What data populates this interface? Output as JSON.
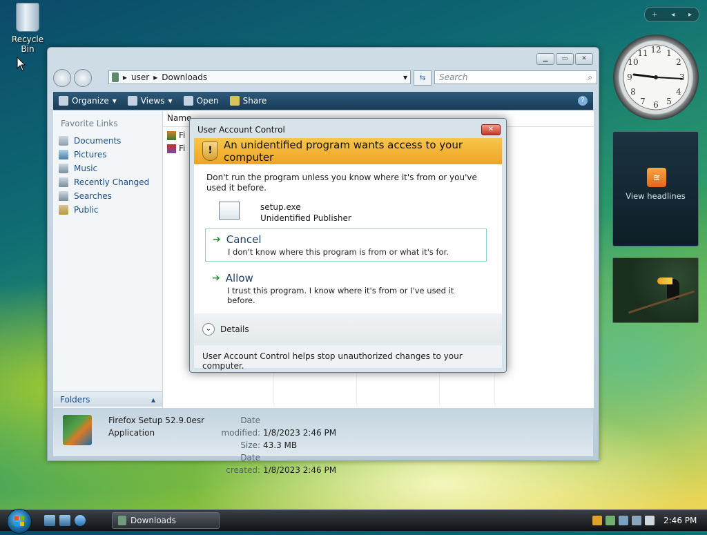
{
  "desktop": {
    "recycle_bin_label": "Recycle Bin"
  },
  "explorer": {
    "window_title": "Downloads",
    "breadcrumb": [
      "user",
      "Downloads"
    ],
    "search_placeholder": "Search",
    "toolbar": {
      "organize": "Organize",
      "views": "Views",
      "open": "Open",
      "share": "Share"
    },
    "favorite_links_title": "Favorite Links",
    "favorite_links": [
      "Documents",
      "Pictures",
      "Music",
      "Recently Changed",
      "Searches",
      "Public"
    ],
    "folders_label": "Folders",
    "column_headers": [
      "Name"
    ],
    "files": [
      {
        "name": "Fi"
      },
      {
        "name": "Fi"
      }
    ],
    "details": {
      "name": "Firefox Setup 52.9.0esr",
      "type": "Application",
      "date_modified_label": "Date modified:",
      "date_modified": "1/8/2023 2:46 PM",
      "size_label": "Size:",
      "size": "43.3 MB",
      "date_created_label": "Date created:",
      "date_created": "1/8/2023 2:46 PM"
    }
  },
  "uac": {
    "title": "User Account Control",
    "headline": "An unidentified program wants access to your computer",
    "warning": "Don't run the program unless you know where it's from or you've used it before.",
    "program_name": "setup.exe",
    "publisher": "Unidentified Publisher",
    "cancel_label": "Cancel",
    "cancel_desc": "I don't know where this program is from or what it's for.",
    "allow_label": "Allow",
    "allow_desc": "I trust this program. I know where it's from or I've used it before.",
    "details_label": "Details",
    "footer_note": "User Account Control helps stop unauthorized changes to your computer."
  },
  "gadgets": {
    "feed_label": "View headlines"
  },
  "taskbar": {
    "task_label": "Downloads",
    "time": "2:46 PM"
  }
}
